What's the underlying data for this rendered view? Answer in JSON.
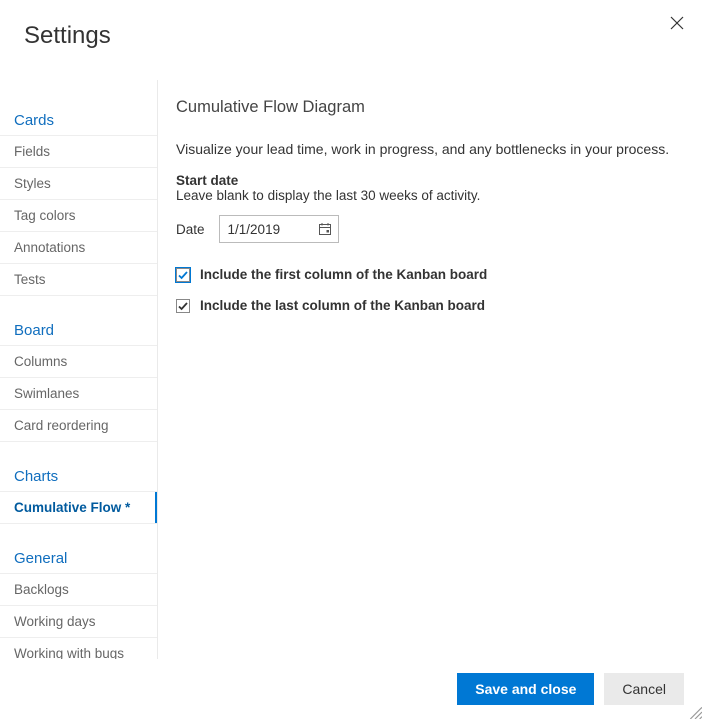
{
  "title": "Settings",
  "sidebar": {
    "sections": [
      {
        "header": "Cards",
        "items": [
          {
            "label": "Fields",
            "selected": false
          },
          {
            "label": "Styles",
            "selected": false
          },
          {
            "label": "Tag colors",
            "selected": false
          },
          {
            "label": "Annotations",
            "selected": false
          },
          {
            "label": "Tests",
            "selected": false
          }
        ]
      },
      {
        "header": "Board",
        "items": [
          {
            "label": "Columns",
            "selected": false
          },
          {
            "label": "Swimlanes",
            "selected": false
          },
          {
            "label": "Card reordering",
            "selected": false
          }
        ]
      },
      {
        "header": "Charts",
        "items": [
          {
            "label": "Cumulative Flow *",
            "selected": true
          }
        ]
      },
      {
        "header": "General",
        "items": [
          {
            "label": "Backlogs",
            "selected": false
          },
          {
            "label": "Working days",
            "selected": false
          },
          {
            "label": "Working with bugs",
            "selected": false
          }
        ]
      }
    ]
  },
  "panel": {
    "title": "Cumulative Flow Diagram",
    "description": "Visualize your lead time, work in progress, and any bottlenecks in your process.",
    "start_date_label": "Start date",
    "start_date_help": "Leave blank to display the last 30 weeks of activity.",
    "date_label": "Date",
    "date_value": "1/1/2019",
    "check_first_label": "Include the first column of the Kanban board",
    "check_first_checked": true,
    "check_last_label": "Include the last column of the Kanban board",
    "check_last_checked": true
  },
  "buttons": {
    "save": "Save and close",
    "cancel": "Cancel"
  }
}
